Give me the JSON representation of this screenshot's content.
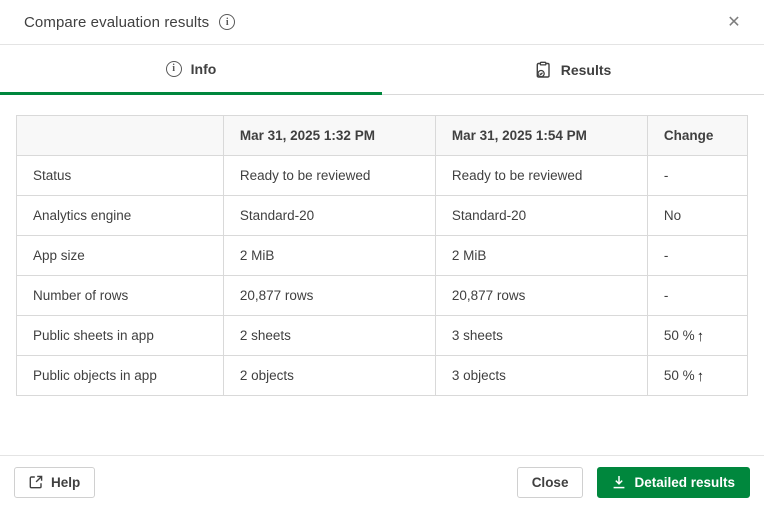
{
  "dialog": {
    "title": "Compare evaluation results",
    "close_glyph": "✕"
  },
  "tabs": {
    "info": {
      "label": "Info",
      "active": true
    },
    "results": {
      "label": "Results",
      "active": false
    }
  },
  "table": {
    "headers": {
      "label": "",
      "eval1": "Mar 31, 2025 1:32 PM",
      "eval2": "Mar 31, 2025 1:54 PM",
      "change": "Change"
    },
    "rows": [
      {
        "label": "Status",
        "eval1": "Ready to be reviewed",
        "eval2": "Ready to be reviewed",
        "change": "-"
      },
      {
        "label": "Analytics engine",
        "eval1": "Standard-20",
        "eval2": "Standard-20",
        "change": "No"
      },
      {
        "label": "App size",
        "eval1": "2 MiB",
        "eval2": "2 MiB",
        "change": "-"
      },
      {
        "label": "Number of rows",
        "eval1": "20,877 rows",
        "eval2": "20,877 rows",
        "change": "-"
      },
      {
        "label": "Public sheets in app",
        "eval1": "2 sheets",
        "eval2": "3 sheets",
        "change": "50 %"
      },
      {
        "label": "Public objects in app",
        "eval1": "2 objects",
        "eval2": "3 objects",
        "change": "50 %"
      }
    ]
  },
  "icons": {
    "info_glyph": "i",
    "up_arrow": "↑"
  },
  "footer": {
    "help_label": "Help",
    "close_label": "Close",
    "detailed_results_label": "Detailed results"
  },
  "colors": {
    "accent_green": "#00873d",
    "header_bg": "#f8f8f8",
    "table_border": "#d9d9d9",
    "text": "#404040"
  }
}
